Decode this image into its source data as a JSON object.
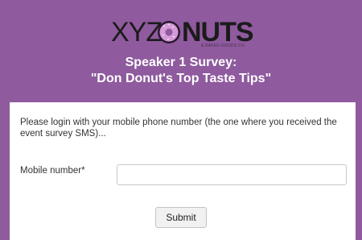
{
  "brand": {
    "logo_left": "XYZ",
    "logo_donut_icon": "donut-icon",
    "logo_right": "NUTS",
    "tagline": "& BAKED GOODS CO."
  },
  "survey": {
    "title_line1": "Speaker 1 Survey:",
    "title_line2": "\"Don Donut's Top Taste Tips\""
  },
  "form": {
    "instructions": "Please login with your mobile phone number (the one where you received the event survey SMS)...",
    "mobile_label": "Mobile number*",
    "mobile_value": "",
    "submit_label": "Submit"
  },
  "colors": {
    "background": "#8f5a9e",
    "panel": "#ffffff",
    "donut_pink": "#d59ad8"
  }
}
